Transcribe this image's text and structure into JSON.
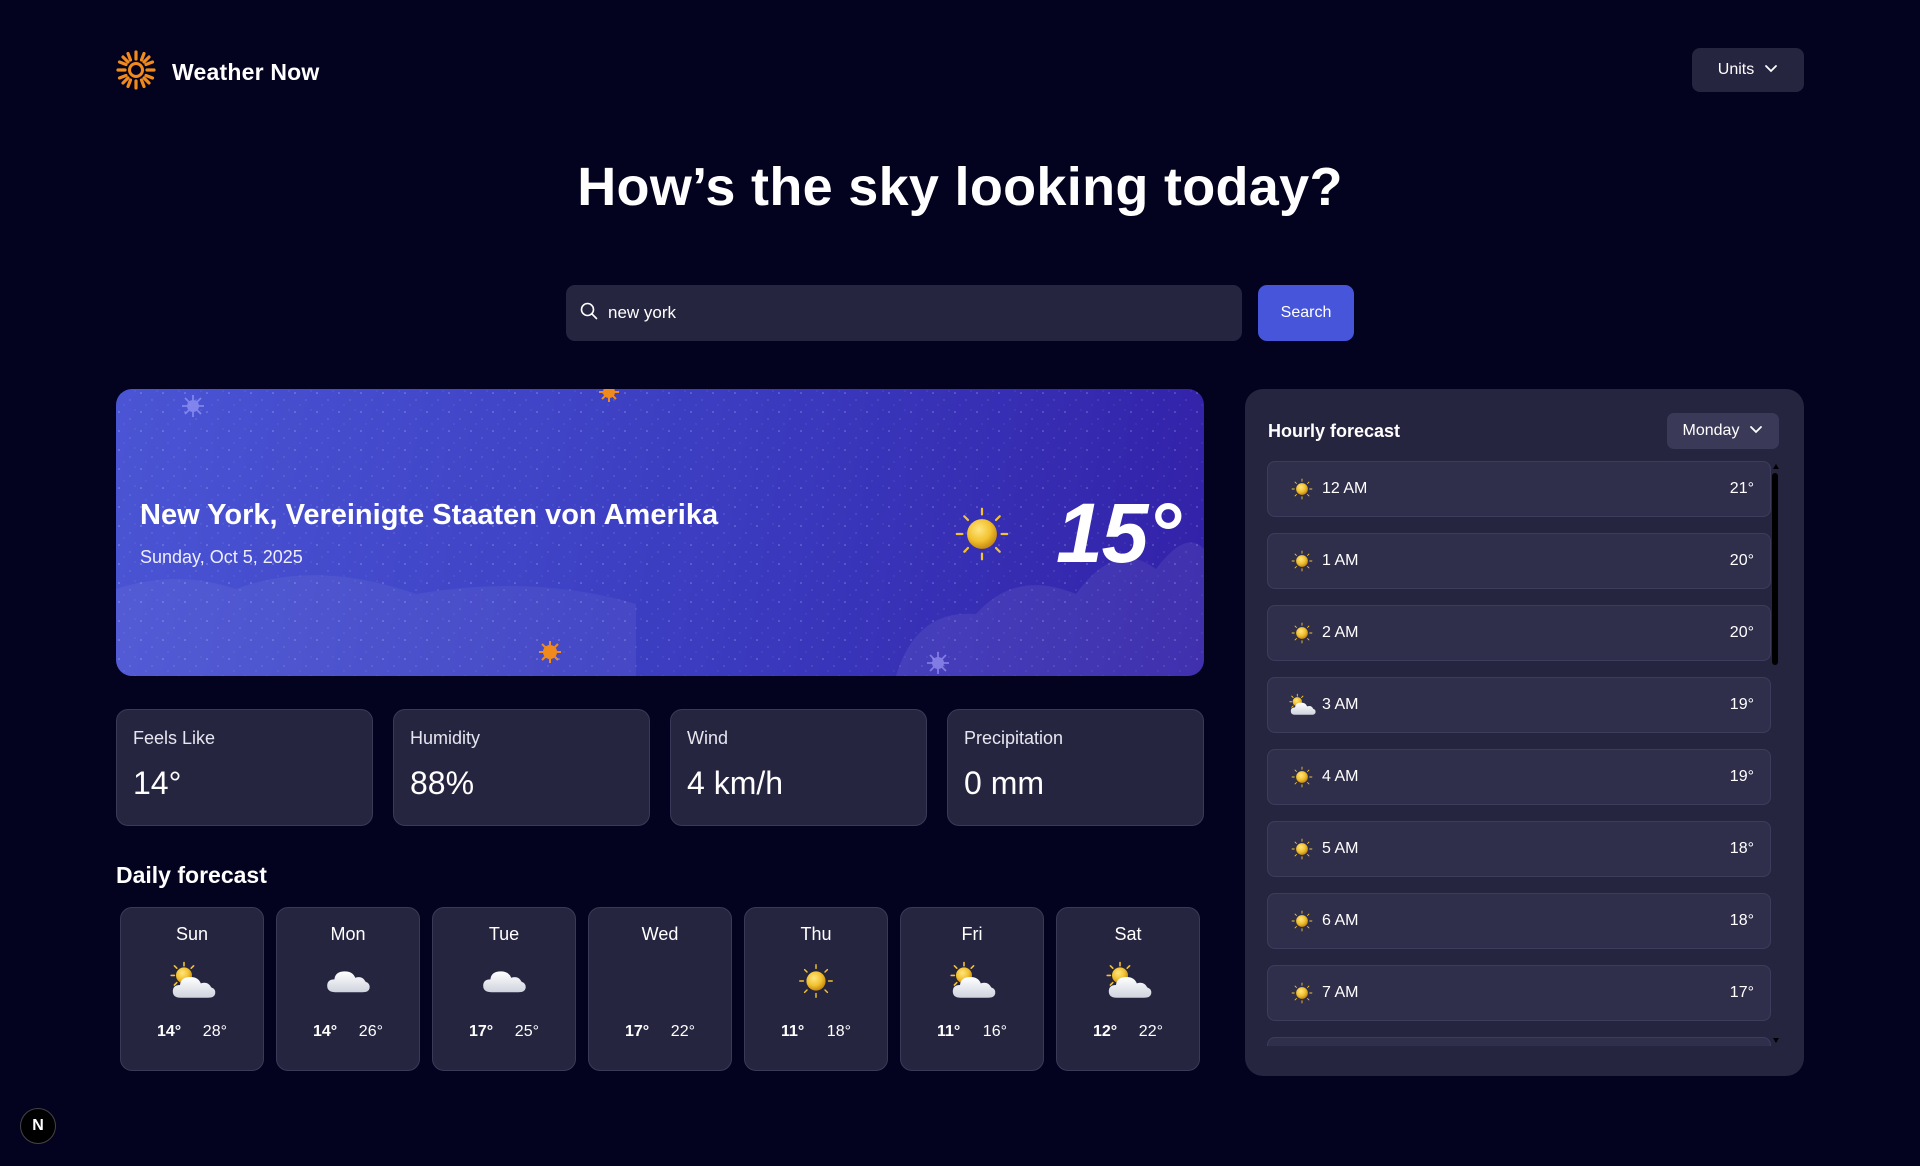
{
  "header": {
    "app_name": "Weather Now",
    "units_label": "Units",
    "headline": "How’s the sky looking today?"
  },
  "search": {
    "value": "new york",
    "button_label": "Search"
  },
  "current": {
    "location": "New York, Vereinigte Staaten von Amerika",
    "date": "Sunday, Oct 5, 2025",
    "temperature": "15°",
    "icon": "sun-icon"
  },
  "stats": [
    {
      "label": "Feels Like",
      "value": "14°"
    },
    {
      "label": "Humidity",
      "value": "88%"
    },
    {
      "label": "Wind",
      "value": "4 km/h"
    },
    {
      "label": "Precipitation",
      "value": "0 mm"
    }
  ],
  "daily": {
    "title": "Daily forecast",
    "days": [
      {
        "day": "Sun",
        "icon": "partly-cloudy-icon",
        "high": "14°",
        "low": "28°"
      },
      {
        "day": "Mon",
        "icon": "cloud-icon",
        "high": "14°",
        "low": "26°"
      },
      {
        "day": "Tue",
        "icon": "cloud-icon",
        "high": "17°",
        "low": "25°"
      },
      {
        "day": "Wed",
        "icon": "none",
        "high": "17°",
        "low": "22°"
      },
      {
        "day": "Thu",
        "icon": "sun-icon",
        "high": "11°",
        "low": "18°"
      },
      {
        "day": "Fri",
        "icon": "partly-cloudy-icon",
        "high": "11°",
        "low": "16°"
      },
      {
        "day": "Sat",
        "icon": "partly-cloudy-icon",
        "high": "12°",
        "low": "22°"
      }
    ]
  },
  "hourly": {
    "title": "Hourly forecast",
    "selected_day": "Monday",
    "hours": [
      {
        "time": "12 AM",
        "icon": "sun-icon",
        "temp": "21°"
      },
      {
        "time": "1 AM",
        "icon": "sun-icon",
        "temp": "20°"
      },
      {
        "time": "2 AM",
        "icon": "sun-icon",
        "temp": "20°"
      },
      {
        "time": "3 AM",
        "icon": "partly-cloudy-icon",
        "temp": "19°"
      },
      {
        "time": "4 AM",
        "icon": "sun-icon",
        "temp": "19°"
      },
      {
        "time": "5 AM",
        "icon": "sun-icon",
        "temp": "18°"
      },
      {
        "time": "6 AM",
        "icon": "sun-icon",
        "temp": "18°"
      },
      {
        "time": "7 AM",
        "icon": "sun-icon",
        "temp": "17°"
      }
    ]
  },
  "colors": {
    "background": "#03021f",
    "card": "#262540",
    "accent": "#4655d9",
    "logo": "#f08a1c"
  },
  "footer": {
    "badge": "N"
  }
}
